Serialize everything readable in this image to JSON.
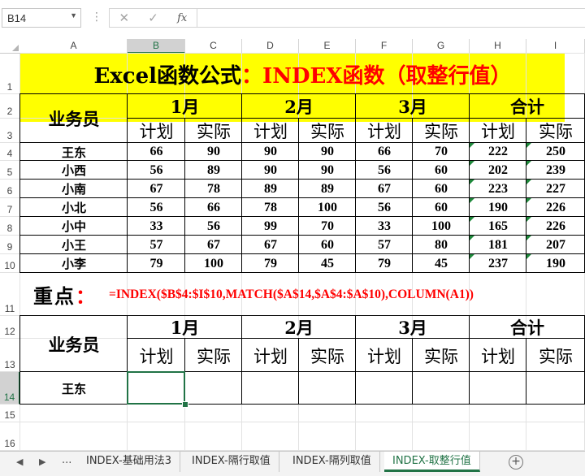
{
  "formula_bar": {
    "name_box": "B14",
    "cancel_icon": "✕",
    "enter_icon": "✓",
    "fx_label": "fx",
    "formula": ""
  },
  "columns": [
    "A",
    "B",
    "C",
    "D",
    "E",
    "F",
    "G",
    "H",
    "I"
  ],
  "rows": [
    "1",
    "2",
    "3",
    "4",
    "5",
    "6",
    "7",
    "8",
    "9",
    "10",
    "11",
    "12",
    "13",
    "14",
    "15",
    "16"
  ],
  "selected": {
    "column": "B",
    "row": "14"
  },
  "title": {
    "black": "Excel函数公式",
    "red": "：INDEX函数（取整行值）"
  },
  "headers": {
    "person": "业务员",
    "months": [
      "1月",
      "2月",
      "3月",
      "合计"
    ],
    "plan": "计划",
    "actual": "实际"
  },
  "table": [
    {
      "name": "王东",
      "values": [
        "66",
        "90",
        "90",
        "90",
        "66",
        "70",
        "222",
        "250"
      ]
    },
    {
      "name": "小西",
      "values": [
        "56",
        "89",
        "90",
        "90",
        "56",
        "60",
        "202",
        "239"
      ]
    },
    {
      "name": "小南",
      "values": [
        "67",
        "78",
        "89",
        "89",
        "67",
        "60",
        "223",
        "227"
      ]
    },
    {
      "name": "小北",
      "values": [
        "56",
        "66",
        "78",
        "100",
        "56",
        "60",
        "190",
        "226"
      ]
    },
    {
      "name": "小中",
      "values": [
        "33",
        "56",
        "99",
        "70",
        "33",
        "100",
        "165",
        "226"
      ]
    },
    {
      "name": "小王",
      "values": [
        "57",
        "67",
        "67",
        "60",
        "57",
        "80",
        "181",
        "207"
      ]
    },
    {
      "name": "小李",
      "values": [
        "79",
        "100",
        "79",
        "45",
        "79",
        "45",
        "237",
        "190"
      ]
    }
  ],
  "keypoint": {
    "label": "重点：",
    "formula": "=INDEX($B$4:$I$10,MATCH($A$14,$A$4:$A$10),COLUMN(A1))"
  },
  "lookup_name": "王东",
  "sheet_tabs": {
    "ellipsis": "...",
    "tabs": [
      "INDEX-基础用法3",
      "INDEX-隔行取值",
      "INDEX-隔列取值",
      "INDEX-取整行值"
    ],
    "active": 3
  },
  "colors": {
    "accent": "#217346",
    "highlight": "#ffff00",
    "red": "#ff0000",
    "error_indicator": "#1f8a3c"
  }
}
